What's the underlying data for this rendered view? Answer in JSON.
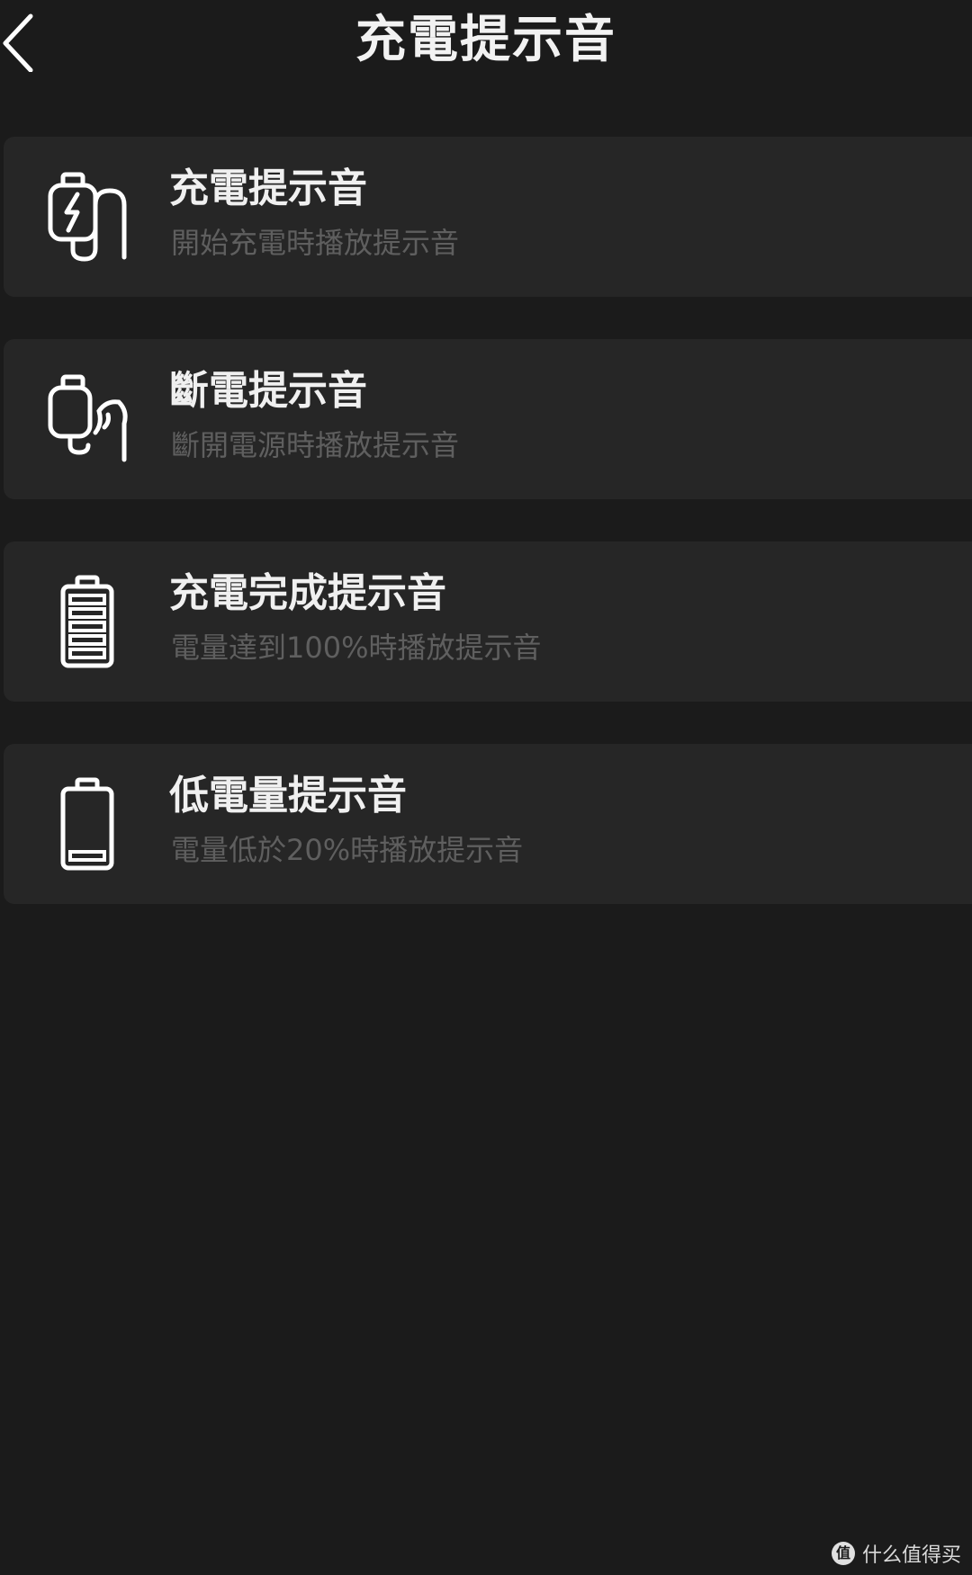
{
  "header": {
    "title": "充電提示音",
    "back_icon": "chevron-left-icon"
  },
  "items": [
    {
      "icon": "charger-plug-icon",
      "title": "充電提示音",
      "description": "開始充電時播放提示音"
    },
    {
      "icon": "unplug-icon",
      "title": "斷電提示音",
      "description": "斷開電源時播放提示音"
    },
    {
      "icon": "battery-full-icon",
      "title": "充電完成提示音",
      "description": "電量達到100%時播放提示音"
    },
    {
      "icon": "battery-low-icon",
      "title": "低電量提示音",
      "description": "電量低於20%時播放提示音"
    }
  ],
  "watermark": {
    "badge": "值",
    "text": "什么值得买"
  },
  "colors": {
    "background": "#1b1b1b",
    "card": "#262626",
    "title_text": "#f0f0f0",
    "description_text": "#5f5f5f"
  }
}
